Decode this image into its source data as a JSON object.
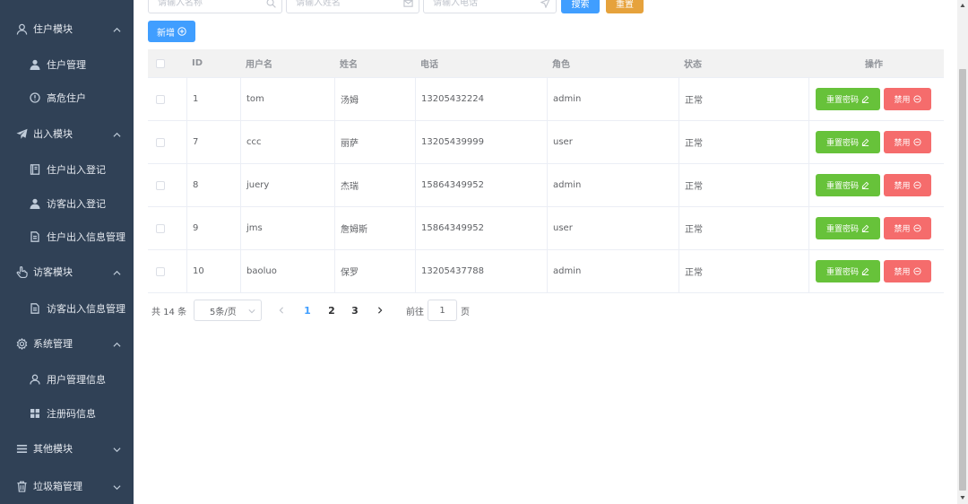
{
  "sidebar": {
    "groups": [
      {
        "label": "住户模块",
        "icon": "user-icon",
        "expanded": true,
        "items": [
          {
            "label": "住户管理",
            "icon": "person-icon"
          },
          {
            "label": "高危住户",
            "icon": "warning-icon"
          }
        ]
      },
      {
        "label": "出入模块",
        "icon": "send-icon",
        "expanded": true,
        "items": [
          {
            "label": "住户出入登记",
            "icon": "notebook-icon"
          },
          {
            "label": "访客出入登记",
            "icon": "person-icon"
          },
          {
            "label": "住户出入信息管理",
            "icon": "document-icon"
          }
        ]
      },
      {
        "label": "访客模块",
        "icon": "pointer-icon",
        "expanded": true,
        "items": [
          {
            "label": "访客出入信息管理",
            "icon": "document-icon"
          }
        ]
      },
      {
        "label": "系统管理",
        "icon": "setting-icon",
        "expanded": true,
        "items": [
          {
            "label": "用户管理信息",
            "icon": "user-icon"
          },
          {
            "label": "注册码信息",
            "icon": "grid-icon"
          }
        ]
      },
      {
        "label": "其他模块",
        "icon": "menu-icon",
        "expanded": false,
        "items": []
      },
      {
        "label": "垃圾箱管理",
        "icon": "trash-icon",
        "expanded": false,
        "items": []
      }
    ]
  },
  "search": {
    "name_placeholder": "请输入名称",
    "realname_placeholder": "请输入姓名",
    "phone_placeholder": "请输入电话",
    "search_label": "搜索",
    "reset_label": "重置"
  },
  "toolbar": {
    "add_label": "新增"
  },
  "table": {
    "columns": [
      "ID",
      "用户名",
      "姓名",
      "电话",
      "角色",
      "状态",
      "操作"
    ],
    "rows": [
      {
        "id": "1",
        "username": "tom",
        "name": "汤姆",
        "phone": "13205432224",
        "role": "admin",
        "status": "正常"
      },
      {
        "id": "7",
        "username": "ccc",
        "name": "丽萨",
        "phone": "13205439999",
        "role": "user",
        "status": "正常"
      },
      {
        "id": "8",
        "username": "juery",
        "name": "杰瑞",
        "phone": "15864349952",
        "role": "admin",
        "status": "正常"
      },
      {
        "id": "9",
        "username": "jms",
        "name": "詹姆斯",
        "phone": "15864349952",
        "role": "user",
        "status": "正常"
      },
      {
        "id": "10",
        "username": "baoluo",
        "name": "保罗",
        "phone": "13205437788",
        "role": "admin",
        "status": "正常"
      }
    ],
    "reset_pwd_label": "重置密码",
    "ban_label": "禁用"
  },
  "pagination": {
    "total_text": "共 14 条",
    "page_size": "5条/页",
    "pages": [
      "1",
      "2",
      "3"
    ],
    "current_page": "1",
    "goto_prefix": "前往",
    "goto_value": "1",
    "goto_suffix": "页"
  },
  "colors": {
    "sidebar_bg": "#304156",
    "primary": "#409eff",
    "warning": "#e6a23c",
    "success": "#67c23a",
    "danger": "#f56c6c"
  }
}
